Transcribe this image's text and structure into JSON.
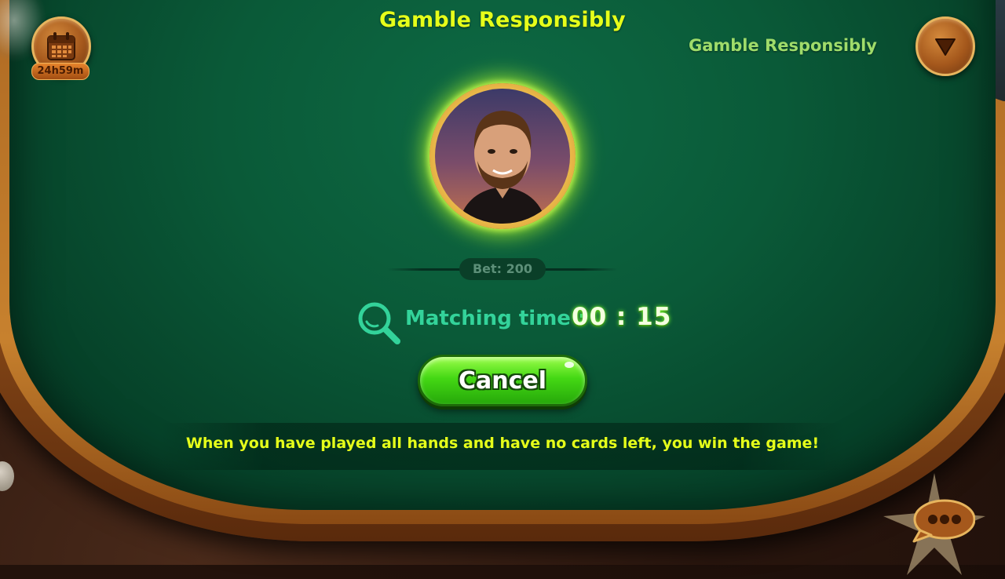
{
  "header": {
    "title": "Gamble Responsibly",
    "subtitle": "Gamble Responsibly"
  },
  "calendar": {
    "icon": "calendar-icon",
    "timer": "24h59m"
  },
  "menu": {
    "icon": "triangle-down-icon"
  },
  "match": {
    "bet_label": "Bet: 200",
    "matching_label": "Matching time :",
    "matching_time": "00 : 15",
    "cancel_label": "Cancel"
  },
  "tip": {
    "text": "When you have played all hands and have no cards left, you win the game!"
  },
  "chat": {
    "icon": "chat-bubble-icon"
  },
  "colors": {
    "felt": "#0a5a38",
    "title": "#e6ff1a",
    "accent_green": "#33d39a",
    "button_green": "#44d814",
    "wood": "#a5581c"
  }
}
